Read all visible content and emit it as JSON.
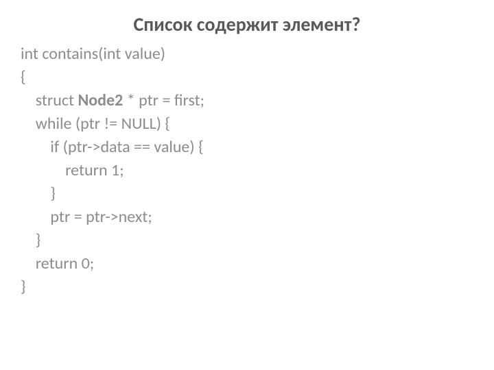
{
  "title": "Список содержит элемент?",
  "code": {
    "l1": "int contains(int value)",
    "l2": "{",
    "l3a": "    struct ",
    "l3b": "Node2",
    "l3c": " * ptr = first;",
    "l4": "    while (ptr != NULL) {",
    "l5": "        if (ptr->data == value) {",
    "l6": "            return 1;",
    "l7": "        }",
    "l8": "        ptr = ptr->next;",
    "l9": "    }",
    "l10": "    return 0;",
    "l11": "}"
  }
}
